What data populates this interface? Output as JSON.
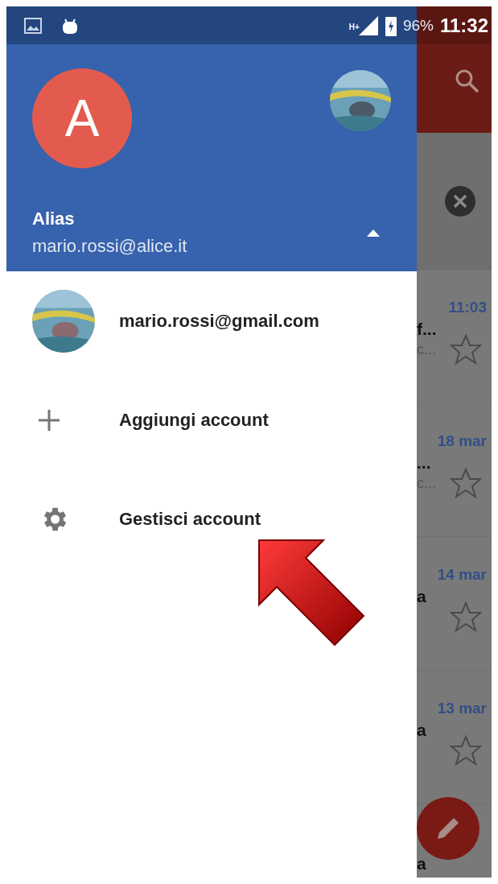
{
  "status_bar": {
    "network": "H+",
    "battery": "96%",
    "time": "11:32"
  },
  "drawer": {
    "header": {
      "avatar_letter": "A",
      "name": "Alias",
      "email": "mario.rossi@alice.it",
      "expanded": true
    },
    "items": [
      {
        "kind": "account",
        "label": "mario.rossi@gmail.com"
      },
      {
        "kind": "add",
        "label": "Aggiungi account"
      },
      {
        "kind": "manage",
        "label": "Gestisci account"
      }
    ]
  },
  "mail_list": [
    {
      "time": "11:03",
      "line_1": "f...",
      "line_2": "c...",
      "starred": false
    },
    {
      "time": "18 mar",
      "line_1": "...",
      "line_2": "c...",
      "starred": false
    },
    {
      "time": "14 mar",
      "line_1": "a",
      "starred": false
    },
    {
      "time": "13 mar",
      "line_1": "a",
      "starred": false
    },
    {
      "line_1": "a"
    }
  ]
}
